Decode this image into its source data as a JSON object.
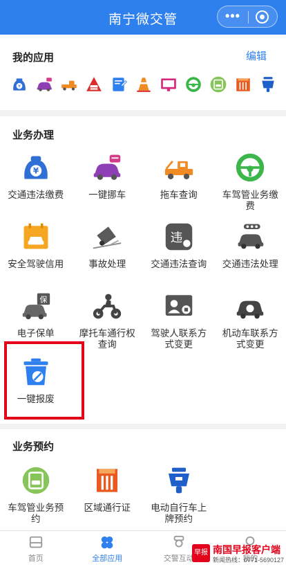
{
  "header": {
    "title": "南宁微交管"
  },
  "my_apps": {
    "title": "我的应用",
    "edit_label": "编辑",
    "icons": [
      "yuan-bag-icon",
      "car-tag-icon",
      "tow-truck-icon",
      "warning-sign-icon",
      "form-icon",
      "traffic-cone-icon",
      "monitor-icon",
      "steering-wheel-icon",
      "calendar-car-icon",
      "gate-icon",
      "scooter-icon"
    ]
  },
  "business": {
    "title": "业务办理",
    "items": [
      {
        "label": "交通违法缴费",
        "icon": "yuan-bag-icon"
      },
      {
        "label": "一键挪车",
        "icon": "car-tag-icon"
      },
      {
        "label": "拖车查询",
        "icon": "tow-truck-icon"
      },
      {
        "label": "车驾管业务缴费",
        "icon": "steering-wheel-icon"
      },
      {
        "label": "安全驾驶信用",
        "icon": "calendar-car-icon"
      },
      {
        "label": "事故处理",
        "icon": "crash-icon"
      },
      {
        "label": "交通违法查询",
        "icon": "violation-icon"
      },
      {
        "label": "交通违法处理",
        "icon": "traffic-light-car-icon"
      },
      {
        "label": "电子保单",
        "icon": "insured-car-icon"
      },
      {
        "label": "摩托车通行权查询",
        "icon": "motorcycle-icon"
      },
      {
        "label": "驾驶人联系方式变更",
        "icon": "id-phone-icon"
      },
      {
        "label": "机动车联系方式变更",
        "icon": "car-phone-icon"
      },
      {
        "label": "一键报废",
        "icon": "scrap-bin-icon"
      }
    ]
  },
  "appointments": {
    "title": "业务预约",
    "items": [
      {
        "label": "车驾管业务预约",
        "icon": "calendar-car-icon"
      },
      {
        "label": "区域通行证",
        "icon": "gate-icon"
      },
      {
        "label": "电动自行车上牌预约",
        "icon": "scooter-icon"
      }
    ]
  },
  "tabbar": {
    "tabs": [
      {
        "label": "首页",
        "active": false
      },
      {
        "label": "全部应用",
        "active": true
      },
      {
        "label": "交警互动",
        "active": false
      },
      {
        "label": "我的",
        "active": false
      }
    ]
  },
  "watermark": {
    "badge": "早报",
    "name": "南国早报客户端",
    "hotline": "新闻热线：0771-5690127"
  },
  "colors": {
    "primary": "#2f80ef",
    "highlight": "#e3001b"
  }
}
